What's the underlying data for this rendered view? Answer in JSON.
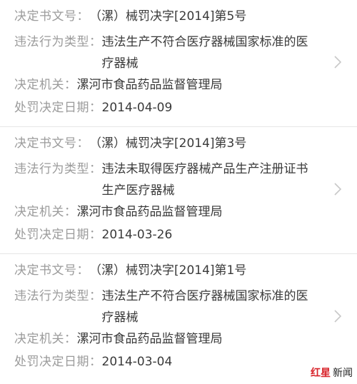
{
  "labels": {
    "doc_no": "决定书文号：",
    "violation_type": "违法行为类型：",
    "authority": "决定机关：",
    "date": "处罚决定日期："
  },
  "records": [
    {
      "doc_no": "（漯）械罚决字[2014]第5号",
      "violation_type": "违法生产不符合医疗器械国家标准的医疗器械",
      "authority": "漯河市食品药品监督管理局",
      "date": "2014-04-09"
    },
    {
      "doc_no": "（漯）械罚决字[2014]第3号",
      "violation_type": "违法未取得医疗器械产品生产注册证书生产医疗器械",
      "authority": "漯河市食品药品监督管理局",
      "date": "2014-03-26"
    },
    {
      "doc_no": "（漯）械罚决字[2014]第1号",
      "violation_type": "违法生产不符合医疗器械国家标准的医疗器械",
      "authority": "漯河市食品药品监督管理局",
      "date": "2014-03-04"
    }
  ],
  "icons": {
    "row_action": "chevron-right-icon"
  },
  "colors": {
    "label": "#9b9b9b",
    "value": "#3a3a3a",
    "chevron": "#c8c8c8",
    "brand": "#d8232a"
  },
  "watermark": {
    "red_part": "红星",
    "dark_part": "新闻"
  }
}
